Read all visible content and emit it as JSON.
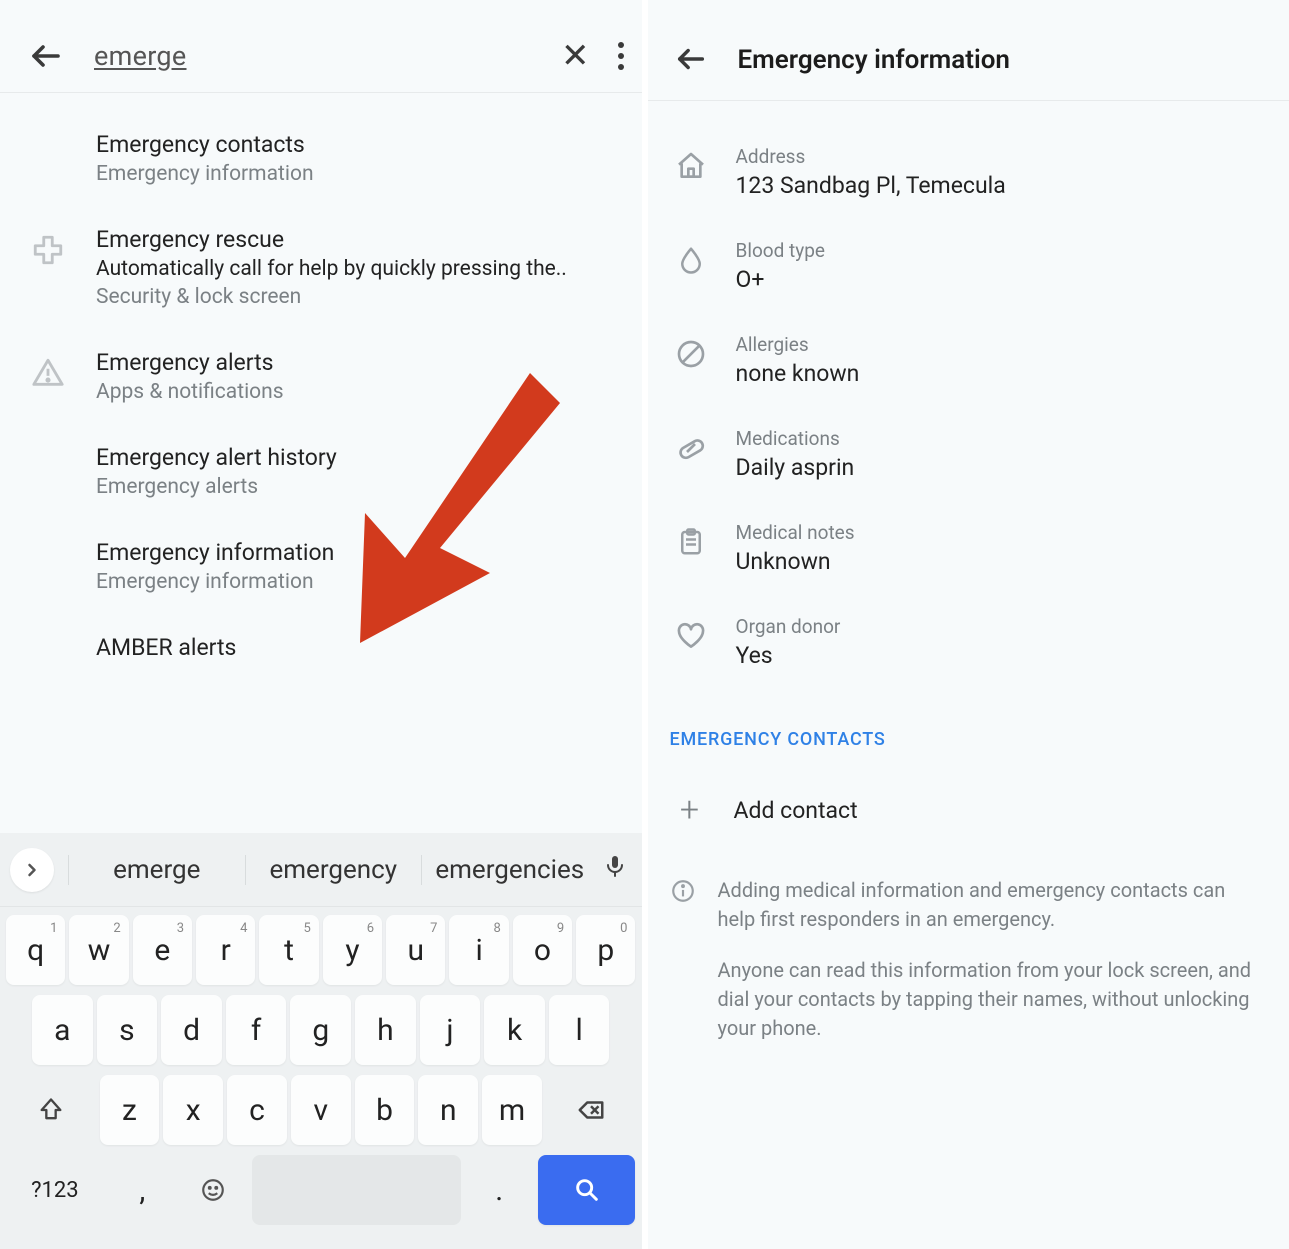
{
  "left": {
    "search_query": "emerge",
    "results": [
      {
        "title": "Emergency contacts",
        "desc": "",
        "path": "Emergency information",
        "icon": ""
      },
      {
        "title": "Emergency rescue",
        "desc": "Automatically call for help by quickly pressing the..",
        "path": "Security & lock screen",
        "icon": "medical"
      },
      {
        "title": "Emergency alerts",
        "desc": "",
        "path": "Apps & notifications",
        "icon": "warning"
      },
      {
        "title": "Emergency alert history",
        "desc": "",
        "path": "Emergency alerts",
        "icon": ""
      },
      {
        "title": "Emergency information",
        "desc": "",
        "path": "Emergency information",
        "icon": ""
      },
      {
        "title": "AMBER alerts",
        "desc": "",
        "path": "",
        "icon": ""
      }
    ],
    "suggestions": [
      "emerge",
      "emergency",
      "emergencies"
    ],
    "keyboard": {
      "row1": [
        "q",
        "w",
        "e",
        "r",
        "t",
        "y",
        "u",
        "i",
        "o",
        "p"
      ],
      "row1_nums": [
        "1",
        "2",
        "3",
        "4",
        "5",
        "6",
        "7",
        "8",
        "9",
        "0"
      ],
      "row2": [
        "a",
        "s",
        "d",
        "f",
        "g",
        "h",
        "j",
        "k",
        "l"
      ],
      "row3": [
        "z",
        "x",
        "c",
        "v",
        "b",
        "n",
        "m"
      ],
      "symkey": "?123",
      "comma": ",",
      "period": "."
    }
  },
  "right": {
    "title": "Emergency information",
    "info": [
      {
        "label": "Address",
        "value": "123 Sandbag Pl, Temecula",
        "icon": "home"
      },
      {
        "label": "Blood type",
        "value": "O+",
        "icon": "blood"
      },
      {
        "label": "Allergies",
        "value": "none known",
        "icon": "no"
      },
      {
        "label": "Medications",
        "value": "Daily asprin",
        "icon": "pill"
      },
      {
        "label": "Medical notes",
        "value": "Unknown",
        "icon": "clipboard"
      },
      {
        "label": "Organ donor",
        "value": "Yes",
        "icon": "heart"
      }
    ],
    "section_header": "EMERGENCY CONTACTS",
    "add_contact_label": "Add contact",
    "note1": "Adding medical information and emergency contacts can help first responders in an emergency.",
    "note2": "Anyone can read this information from your lock screen, and dial your contacts by tapping their names, without unlocking your phone."
  }
}
